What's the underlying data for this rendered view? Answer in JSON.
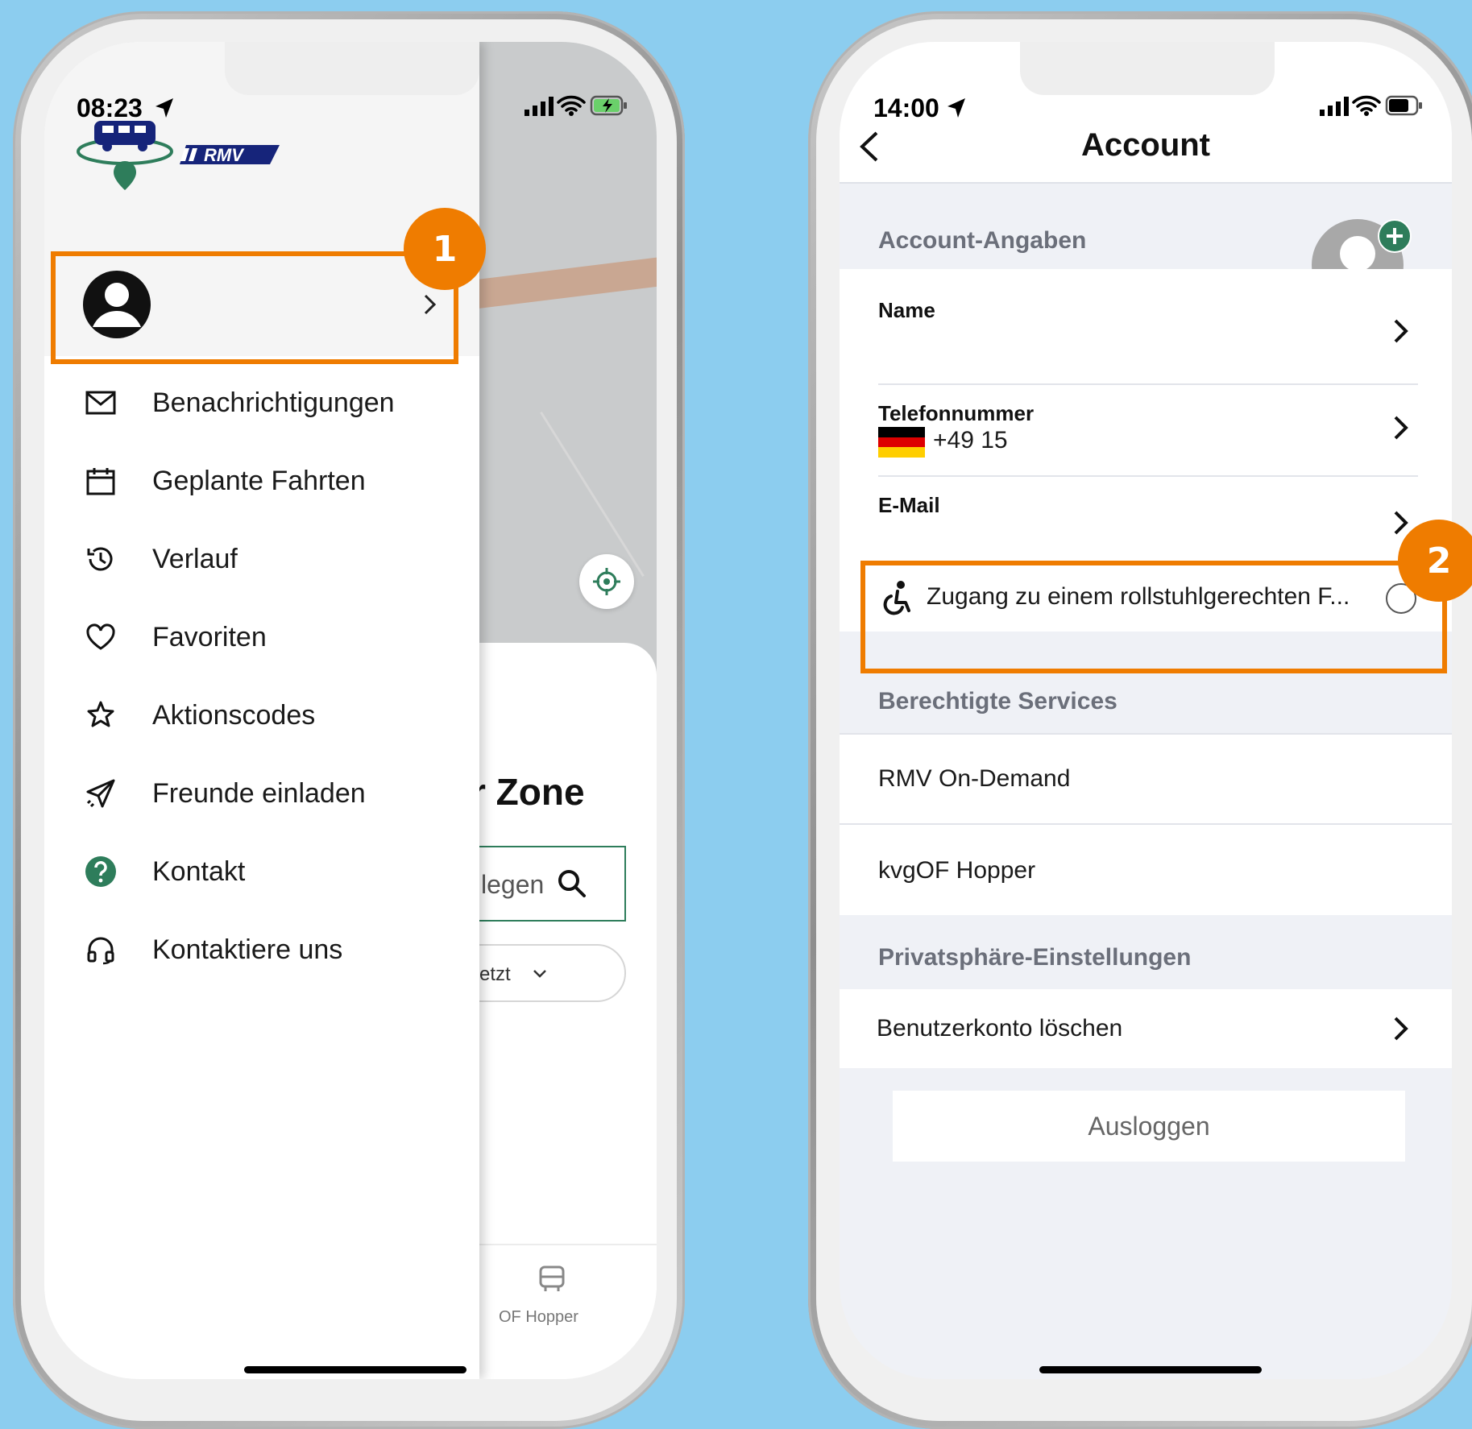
{
  "colors": {
    "background": "#8ccdef",
    "accent": "#ef7c00",
    "brand_green": "#2e7d5b",
    "brand_navy": "#16247a"
  },
  "left_phone": {
    "status": {
      "time": "08:23"
    },
    "logo": {
      "brand": "RMV"
    },
    "callout_number": "1",
    "menu": [
      {
        "icon": "envelope-icon",
        "label": "Benachrichtigungen"
      },
      {
        "icon": "calendar-icon",
        "label": "Geplante Fahrten"
      },
      {
        "icon": "history-icon",
        "label": "Verlauf"
      },
      {
        "icon": "heart-icon",
        "label": "Favoriten"
      },
      {
        "icon": "tag-star-icon",
        "label": "Aktionscodes"
      },
      {
        "icon": "paper-plane-icon",
        "label": "Freunde einladen"
      },
      {
        "icon": "help-circle-icon",
        "label": "Kontakt"
      },
      {
        "icon": "headset-icon",
        "label": "Kontaktiere uns"
      }
    ],
    "background_app": {
      "title_fragment": "r Zone",
      "search_fragment": "legen",
      "time_fragment": "Jetzt",
      "tab_fragment": "OF Hopper"
    }
  },
  "right_phone": {
    "status": {
      "time": "14:00"
    },
    "header": {
      "title": "Account"
    },
    "callout_number": "2",
    "account_section": {
      "title": "Account-Angaben",
      "name_label": "Name",
      "phone_label": "Telefonnummer",
      "phone_value": "+49 15",
      "email_label": "E-Mail",
      "wheelchair_text": "Zugang zu einem rollstuhlgerechten F..."
    },
    "services_section": {
      "title": "Berechtigte Services",
      "items": [
        "RMV On-Demand",
        "kvgOF Hopper"
      ]
    },
    "privacy_section": {
      "title": "Privatsphäre-Einstellungen",
      "delete_label": "Benutzerkonto löschen"
    },
    "logout_label": "Ausloggen"
  }
}
